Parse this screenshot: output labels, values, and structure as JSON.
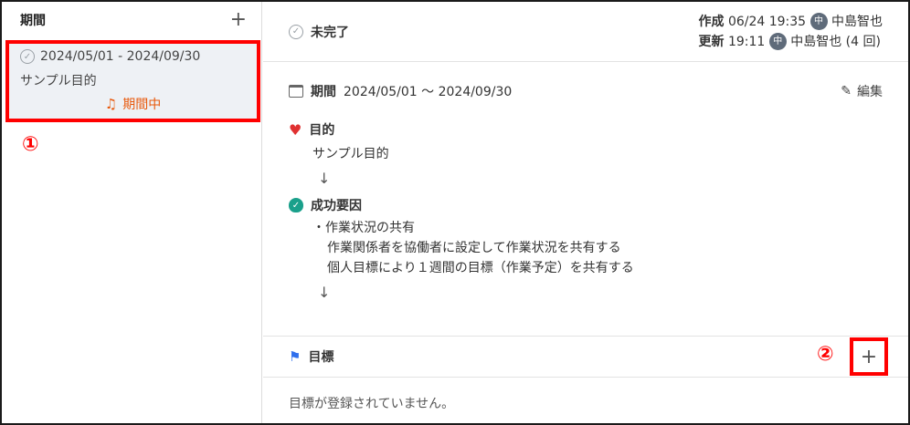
{
  "sidebar": {
    "title": "期間",
    "add_icon": "plus-icon",
    "period": {
      "range": "2024/05/01 - 2024/09/30",
      "purpose": "サンプル目的",
      "status": "期間中"
    }
  },
  "annotations": {
    "marker1": "①",
    "marker2": "②"
  },
  "header": {
    "status": "未完了",
    "created_label": "作成",
    "created_time": "06/24 19:35",
    "created_avatar": "中",
    "created_user": "中島智也",
    "updated_label": "更新",
    "updated_time": "19:11",
    "updated_avatar": "中",
    "updated_user": "中島智也",
    "updated_count": "(4 回)"
  },
  "period_section": {
    "label": "期間",
    "range": "2024/05/01 〜 2024/09/30",
    "edit_label": "編集"
  },
  "purpose_section": {
    "label": "目的",
    "text": "サンプル目的",
    "arrow": "↓"
  },
  "success_section": {
    "label": "成功要因",
    "lines": [
      "・作業状況の共有",
      "作業関係者を協働者に設定して作業状況を共有する",
      "個人目標により１週間の目標（作業予定）を共有する"
    ],
    "arrow": "↓"
  },
  "goal_section": {
    "label": "目標",
    "add_symbol": "+",
    "empty_text": "目標が登録されていません。"
  },
  "colors": {
    "accent_red": "#ff0000",
    "status_orange": "#e8590c",
    "heart": "#e03131",
    "success": "#1aa08b",
    "flag": "#2f6fed"
  }
}
